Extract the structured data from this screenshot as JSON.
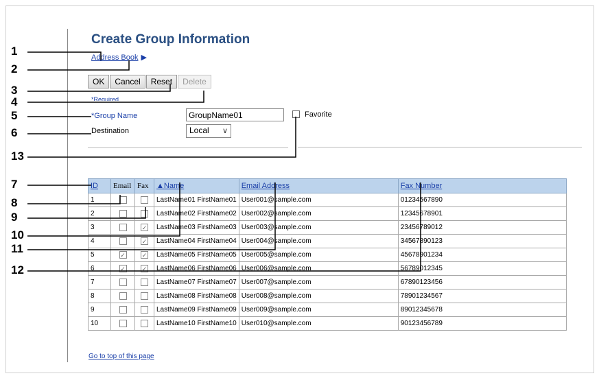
{
  "page": {
    "title": "Create Group Information",
    "breadcrumb": "Address Book",
    "breadcrumb_arrow": "▶",
    "required_note": "*Required",
    "go_top": "Go to top of this page"
  },
  "toolbar": {
    "ok": "OK",
    "cancel": "Cancel",
    "reset": "Reset",
    "delete": "Delete"
  },
  "form": {
    "group_name_label": "*Group Name",
    "group_name_value": "GroupName01",
    "favorite_label": "Favorite",
    "destination_label": "Destination",
    "destination_value": "Local",
    "destination_chevron": "∨"
  },
  "table": {
    "headers": {
      "id": "ID",
      "email": "Email",
      "fax": "Fax",
      "name": "▲Name",
      "email_address": "Email Address",
      "fax_number": "Fax Number"
    },
    "rows": [
      {
        "id": "1",
        "email": false,
        "fax": false,
        "name": "LastName01 FirstName01",
        "email_address": "User001@sample.com",
        "fax_number": "01234567890"
      },
      {
        "id": "2",
        "email": false,
        "fax": false,
        "name": "LastName02 FirstName02",
        "email_address": "User002@sample.com",
        "fax_number": "12345678901"
      },
      {
        "id": "3",
        "email": false,
        "fax": true,
        "name": "LastName03 FirstName03",
        "email_address": "User003@sample.com",
        "fax_number": "23456789012"
      },
      {
        "id": "4",
        "email": false,
        "fax": true,
        "name": "LastName04 FirstName04",
        "email_address": "User004@sample.com",
        "fax_number": "34567890123"
      },
      {
        "id": "5",
        "email": true,
        "fax": true,
        "name": "LastName05 FirstName05",
        "email_address": "User005@sample.com",
        "fax_number": "45678901234"
      },
      {
        "id": "6",
        "email": true,
        "fax": true,
        "name": "LastName06 FirstName06",
        "email_address": "User006@sample.com",
        "fax_number": "56789012345"
      },
      {
        "id": "7",
        "email": false,
        "fax": false,
        "name": "LastName07 FirstName07",
        "email_address": "User007@sample.com",
        "fax_number": "67890123456"
      },
      {
        "id": "8",
        "email": false,
        "fax": false,
        "name": "LastName08 FirstName08",
        "email_address": "User008@sample.com",
        "fax_number": "78901234567"
      },
      {
        "id": "9",
        "email": false,
        "fax": false,
        "name": "LastName09 FirstName09",
        "email_address": "User009@sample.com",
        "fax_number": "89012345678"
      },
      {
        "id": "10",
        "email": false,
        "fax": false,
        "name": "LastName10 FirstName10",
        "email_address": "User010@sample.com",
        "fax_number": "90123456789"
      }
    ]
  },
  "callouts": [
    "1",
    "2",
    "3",
    "4",
    "5",
    "6",
    "13",
    "7",
    "8",
    "9",
    "10",
    "11",
    "12"
  ]
}
